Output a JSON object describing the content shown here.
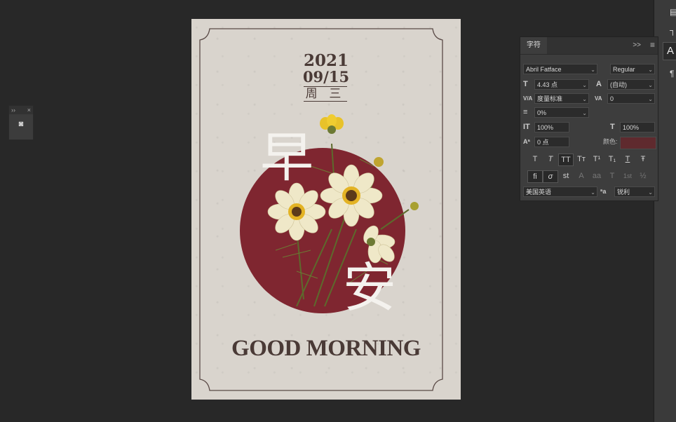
{
  "poster": {
    "year": "2021",
    "month_day": "09/15",
    "weekday": "周 三",
    "char_top": "早",
    "char_bottom": "安",
    "greeting": "GOOD MORNING",
    "circle_color": "#7f2630",
    "text_color": "#4a3a36"
  },
  "character_panel": {
    "tab_label": "字符",
    "more_icon": ">>",
    "menu_icon": "≡",
    "font_family": "Abril Fatface",
    "font_style": "Regular",
    "font_size_icon": "T",
    "font_size": "4.43 点",
    "leading_icon": "A",
    "leading": "(自动)",
    "kerning_icon": "V/A",
    "kerning": "度量标准",
    "tracking_icon": "VA",
    "tracking": "0",
    "tsume_icon": "≡",
    "tsume": "0%",
    "vscale_icon": "IT",
    "vertical_scale": "100%",
    "hscale_icon": "T",
    "horizontal_scale": "100%",
    "baseline_icon": "Aª",
    "baseline_shift": "0 点",
    "color_label": "颜色:",
    "color_swatch": "#5f2a2e",
    "style_buttons": [
      "T",
      "T",
      "TT",
      "Tт",
      "T¹",
      "T₁",
      "T",
      "Ŧ"
    ],
    "opentype_buttons": [
      "fi",
      "σ",
      "st",
      "A",
      "aa",
      "T",
      "1st",
      "½"
    ],
    "language": "美国英语",
    "aa_icon": "ªa",
    "antialias": "锐利"
  },
  "float_tool": {
    "collapse_icon": "››",
    "close_icon": "×",
    "tool_icon": "◙"
  },
  "right_strip": {
    "a_button": "A"
  }
}
